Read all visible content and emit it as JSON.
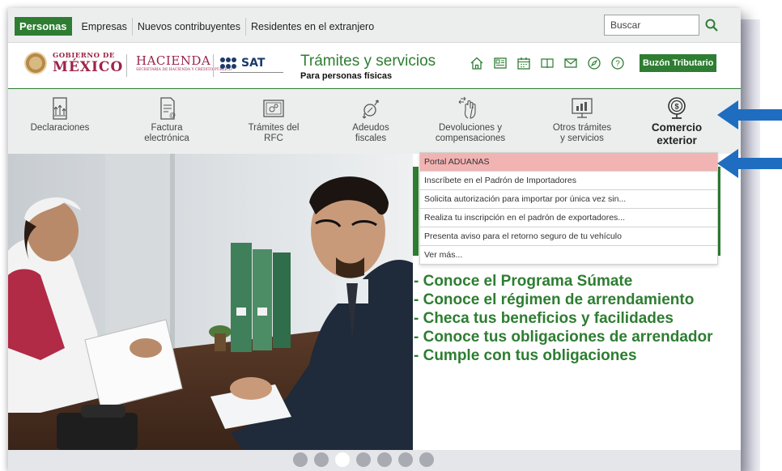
{
  "topnav": {
    "tabs": [
      "Personas",
      "Empresas",
      "Nuevos contribuyentes",
      "Residentes en el extranjero"
    ],
    "active_tab": "Personas",
    "search_placeholder": "Buscar"
  },
  "header": {
    "gob_small": "GOBIERNO DE",
    "gob_big": "MÉXICO",
    "hacienda": "HACIENDA",
    "hacienda_small": "SECRETARÍA DE HACIENDA Y CRÉDITO PÚBLICO",
    "sat": "SAT",
    "title": "Trámites y servicios",
    "subtitle": "Para personas físicas",
    "icons": [
      "home-icon",
      "newspaper-icon",
      "calendar-icon",
      "book-icon",
      "mail-icon",
      "compass-icon",
      "help-icon"
    ],
    "buzon": "Buzón Tributario"
  },
  "categories": [
    {
      "label1": "Declaraciones",
      "label2": "",
      "icon": "declaraciones-icon"
    },
    {
      "label1": "Factura",
      "label2": "electrónica",
      "icon": "factura-icon"
    },
    {
      "label1": "Trámites del",
      "label2": "RFC",
      "icon": "rfc-icon"
    },
    {
      "label1": "Adeudos",
      "label2": "fiscales",
      "icon": "adeudos-icon"
    },
    {
      "label1": "Devoluciones y",
      "label2": "compensaciones",
      "icon": "devoluciones-icon"
    },
    {
      "label1": "Otros trámites",
      "label2": "y servicios",
      "icon": "otros-tramites-icon"
    },
    {
      "label1": "Comercio",
      "label2": "exterior",
      "icon": "globe-dollar-icon"
    }
  ],
  "dropdown": [
    "Portal ADUANAS",
    "Inscríbete en el Padrón de Importadores",
    "Solicita autorización para importar por única vez sin...",
    "Realiza tu inscripción en el padrón de exportadores...",
    "Presenta aviso para el retorno seguro de tu vehículo",
    "Ver más..."
  ],
  "hero_bullets": [
    "- Conoce el Programa Súmate",
    "- Conoce el régimen de arrendamiento",
    "- Checa tus beneficios y facilidades",
    "- Conoce tus obligaciones de arrendador",
    "- Cumple con tus obligaciones"
  ],
  "carousel": {
    "count": 7,
    "active": 3
  },
  "colors": {
    "brand_green": "#2e7d32",
    "gob_red": "#9d2449",
    "highlight": "#f2b3b3",
    "arrow_blue": "#1f6dc0"
  }
}
